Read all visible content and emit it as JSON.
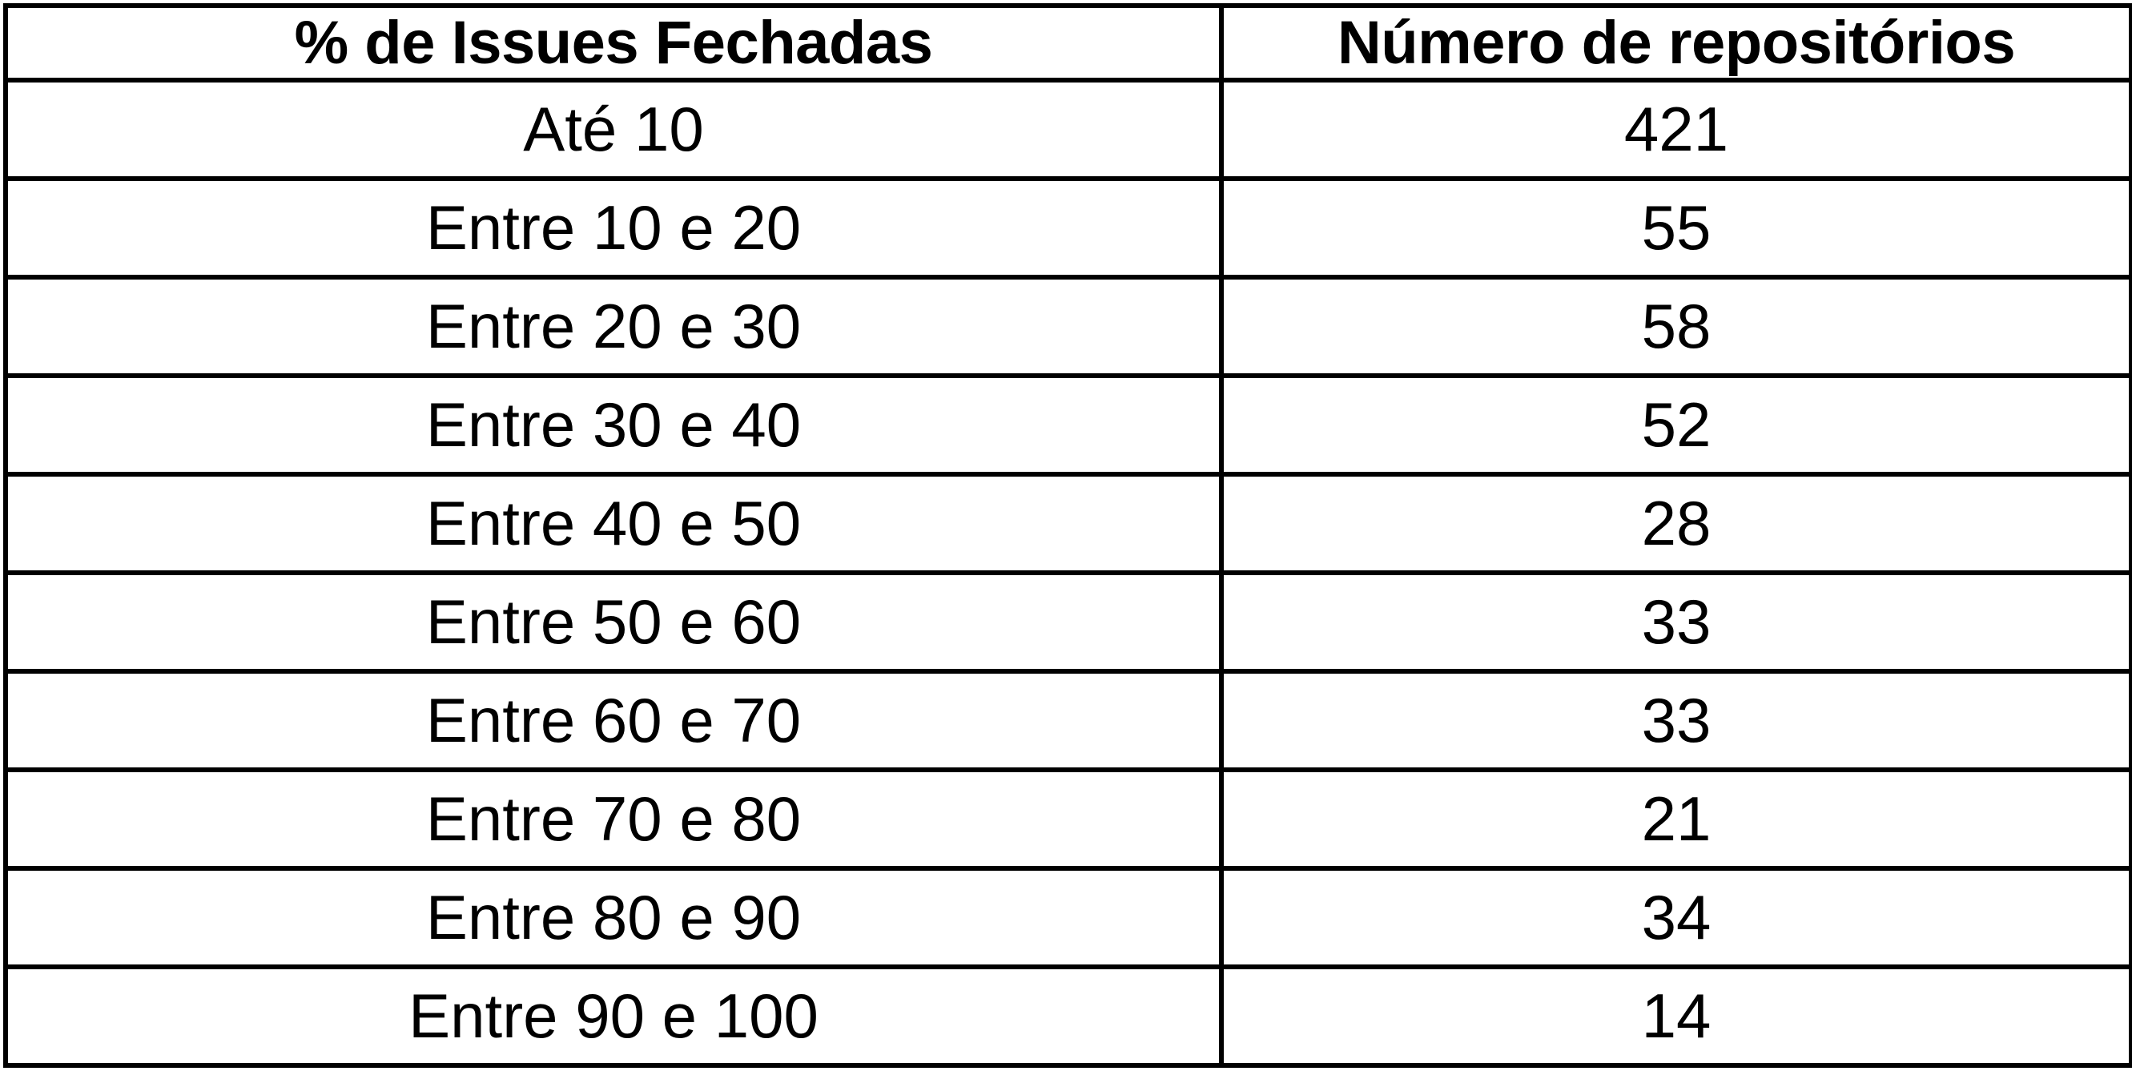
{
  "table": {
    "headers": [
      "% de Issues Fechadas",
      "Número de repositórios"
    ],
    "rows": [
      [
        "Até 10",
        "421"
      ],
      [
        "Entre 10 e 20",
        "55"
      ],
      [
        "Entre 20 e 30",
        "58"
      ],
      [
        "Entre 30 e 40",
        "52"
      ],
      [
        "Entre 40 e 50",
        "28"
      ],
      [
        "Entre 50 e 60",
        "33"
      ],
      [
        "Entre 60 e 70",
        "33"
      ],
      [
        "Entre 70 e 80",
        "21"
      ],
      [
        "Entre 80 e 90",
        "34"
      ],
      [
        "Entre 90 e 100",
        "14"
      ]
    ]
  },
  "chart_data": {
    "type": "table",
    "columns": [
      "% de Issues Fechadas",
      "Número de repositórios"
    ],
    "categories": [
      "Até 10",
      "Entre 10 e 20",
      "Entre 20 e 30",
      "Entre 30 e 40",
      "Entre 40 e 50",
      "Entre 50 e 60",
      "Entre 60 e 70",
      "Entre 70 e 80",
      "Entre 80 e 90",
      "Entre 90 e 100"
    ],
    "values": [
      421,
      55,
      58,
      52,
      28,
      33,
      33,
      21,
      34,
      14
    ]
  }
}
